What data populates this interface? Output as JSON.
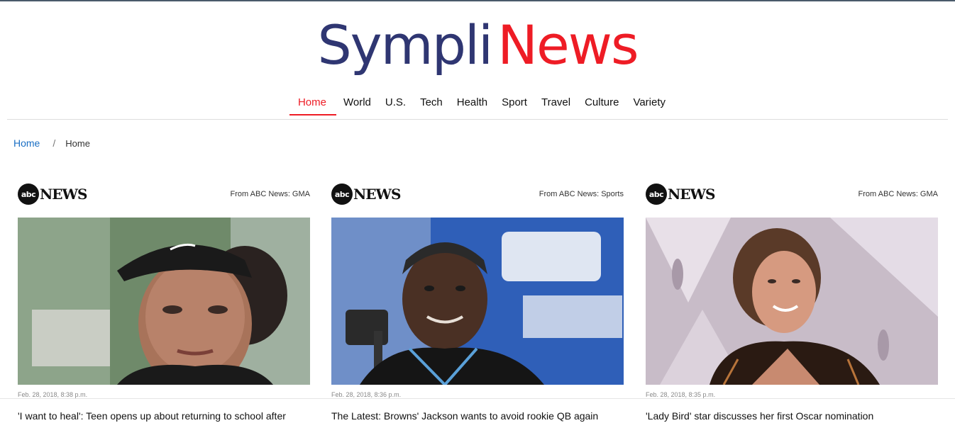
{
  "logo": {
    "part1": "Sympli",
    "part2": "News"
  },
  "nav": {
    "items": [
      {
        "label": "Home",
        "active": true
      },
      {
        "label": "World"
      },
      {
        "label": "U.S."
      },
      {
        "label": "Tech"
      },
      {
        "label": "Health"
      },
      {
        "label": "Sport"
      },
      {
        "label": "Travel"
      },
      {
        "label": "Culture"
      },
      {
        "label": "Variety"
      }
    ]
  },
  "breadcrumb": {
    "link": "Home",
    "separator": "/",
    "current": "Home"
  },
  "cards": [
    {
      "logo_circle": "abc",
      "logo_text": "NEWS",
      "source": "From ABC News: GMA",
      "date": "Feb. 28, 2018, 8:38 p.m.",
      "headline": "'I want to heal': Teen opens up about returning to school after"
    },
    {
      "logo_circle": "abc",
      "logo_text": "NEWS",
      "source": "From ABC News: Sports",
      "date": "Feb. 28, 2018, 8:36 p.m.",
      "headline": "The Latest: Browns' Jackson wants to avoid rookie QB again"
    },
    {
      "logo_circle": "abc",
      "logo_text": "NEWS",
      "source": "From ABC News: GMA",
      "date": "Feb. 28, 2018, 8:35 p.m.",
      "headline": "'Lady Bird' star discusses her first Oscar nomination"
    }
  ],
  "colors": {
    "brand_dark": "#2f3672",
    "brand_red": "#ee1c25",
    "link": "#1a6fc4"
  }
}
